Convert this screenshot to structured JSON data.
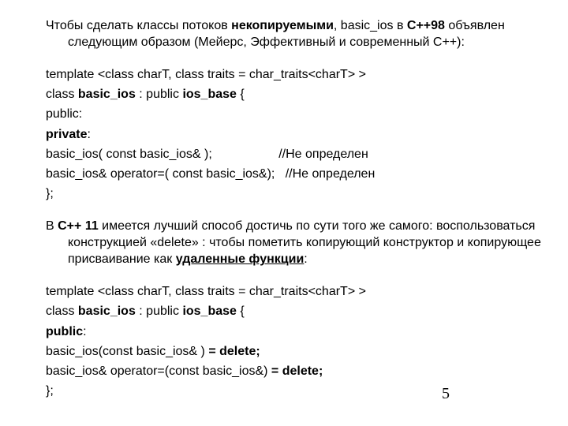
{
  "page_number": "5",
  "p1a": "Чтобы сделать классы потоков ",
  "p1b": "некопируемыми",
  "p1c": ", basic_ios в ",
  "p1d": "С++98",
  "p1e": " объявлен следующим образом (Мейерс, Эффективный и современный С++):",
  "tmpl": "template <class charT, class traits = char_traits<charT> >",
  "cls1a": "class ",
  "cls1b": "basic_ios",
  "cls1c": " : public ",
  "cls1d": "ios_base",
  "cls1e": " {",
  "pub": "public:",
  "priv": "private",
  "priv_colon": ":",
  "ctor98": "basic_ios( const basic_ios& );                   //Не определен",
  "assn98": "basic_ios& operator=( const basic_ios&);   //Не определен",
  "close": "};",
  "p2a": "В ",
  "p2b": "С++ 11",
  "p2c": " имеется лучший способ достичь по сути того же самого: воспользоваться конструкцией «delete» : чтобы пометить копирующий конструктор и копирующее присваивание как ",
  "p2d": "удаленные функции",
  "p2e": ":",
  "cls2a": "class ",
  "cls2b": "basic_ios",
  "cls2c": " : public  ",
  "cls2d": "ios_base",
  "cls2e": " {",
  "pub2": "public",
  "pub2_colon": ":",
  "ctor11a": "basic_ios(const basic_ios& ) ",
  "ctor11b": "= delete;",
  "assn11a": "basic_ios& operator=(const basic_ios&) ",
  "assn11b": "= delete;"
}
